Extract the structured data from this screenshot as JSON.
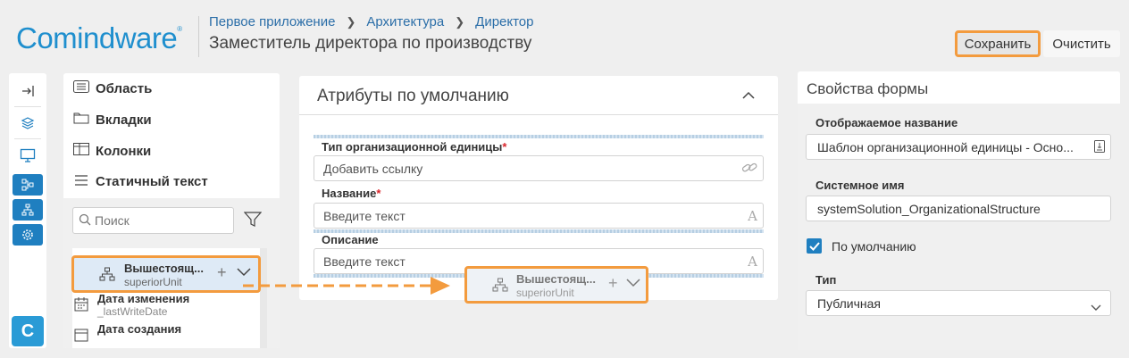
{
  "header": {
    "logo": "Comindware",
    "logo_mark": "®",
    "breadcrumbs": [
      "Первое приложение",
      "Архитектура",
      "Директор"
    ],
    "page_title": "Заместитель директора по производству",
    "save_label": "Сохранить",
    "clear_label": "Очистить"
  },
  "rail": {
    "icons": [
      "collapse-icon",
      "layers-icon",
      "monitor-icon",
      "flow-icon",
      "org-structure-icon",
      "gear-icon"
    ],
    "app_logo": "C"
  },
  "left_panel": {
    "categories": [
      {
        "label": "Область",
        "icon": "list-icon"
      },
      {
        "label": "Вкладки",
        "icon": "folder-icon"
      },
      {
        "label": "Колонки",
        "icon": "columns-icon"
      },
      {
        "label": "Статичный текст",
        "icon": "text-icon"
      }
    ],
    "search_placeholder": "Поиск",
    "attributes": [
      {
        "title": "Дата изменения",
        "system": "_lastWriteDate",
        "icon": "calendar-icon"
      },
      {
        "title": "Дата создания",
        "system": "",
        "icon": "calendar-icon"
      }
    ],
    "selected_attribute": {
      "title": "Вышестоящ...",
      "system": "superiorUnit"
    }
  },
  "center_panel": {
    "title": "Атрибуты по умолчанию",
    "fields": [
      {
        "label": "Тип организационной единицы",
        "required": "*",
        "placeholder": "Добавить ссылку"
      },
      {
        "label": "Название",
        "required": "*",
        "placeholder": "Введите текст"
      },
      {
        "label": "Описание",
        "required": "",
        "placeholder": "Введите текст"
      }
    ],
    "drag_ghost": {
      "title": "Вышестоящ...",
      "system": "superiorUnit"
    }
  },
  "right_panel": {
    "title": "Свойства формы",
    "display_name_label": "Отображаемое название",
    "display_name_value": "Шаблон организационной единицы - Осно...",
    "system_name_label": "Системное имя",
    "system_name_value": "systemSolution_OrganizationalStructure",
    "default_label": "По умолчанию",
    "default_checked": true,
    "type_label": "Тип",
    "type_value": "Публичная"
  },
  "colors": {
    "accent": "#1f7fc0",
    "highlight": "#f39b3e",
    "required": "#d9262c"
  }
}
